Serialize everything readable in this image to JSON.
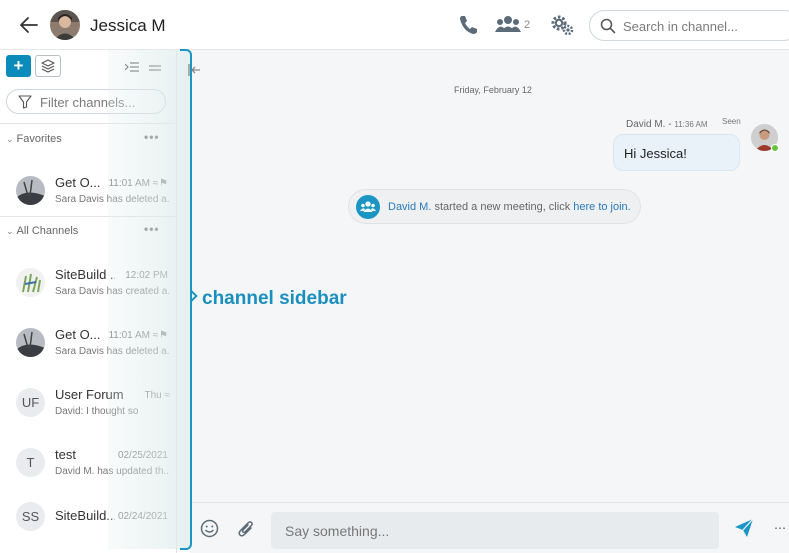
{
  "header": {
    "title": "Jessica M",
    "participant_count": "2",
    "search_placeholder": "Search in channel..."
  },
  "sidebar": {
    "filter_placeholder": "Filter channels...",
    "add_label": "+",
    "favorites_label": "Favorites",
    "all_channels_label": "All Channels",
    "more_label": "•••",
    "favorites": [
      {
        "name": "Get O...",
        "time": "11:01 AM",
        "preview": "Sara Davis has deleted a...",
        "avatar": "image",
        "muted": true,
        "flagged": true
      }
    ],
    "channels": [
      {
        "name": "SiteBuild ...",
        "time": "12:02 PM",
        "preview": "Sara Davis has created a...",
        "avatar": "image"
      },
      {
        "name": "Get O...",
        "time": "11:01 AM",
        "preview": "Sara Davis has deleted a...",
        "avatar": "image",
        "muted": true,
        "flagged": true
      },
      {
        "name": "User Forum",
        "time": "Thu",
        "preview": "David: I thought so",
        "avatar": "UF",
        "muted": true
      },
      {
        "name": "test",
        "time": "02/25/2021",
        "preview": "David M. has updated th...",
        "avatar": "T"
      },
      {
        "name": "SiteBuild...",
        "time": "02/24/2021",
        "preview": "",
        "avatar": "SS"
      }
    ]
  },
  "annotation": {
    "label": "channel sidebar"
  },
  "conversation": {
    "date_separator": "Friday, February 12",
    "message": {
      "author": "David M. -",
      "time": "11:36 AM",
      "status": "Seen",
      "text": "Hi Jessica!"
    },
    "system_event": {
      "actor": "David M.",
      "text": " started a new meeting, click ",
      "link": "here to join."
    }
  },
  "composer": {
    "placeholder": "Say something..."
  },
  "colors": {
    "accent": "#0b8bba",
    "callout": "#1a8fbe",
    "online": "#64c440"
  }
}
